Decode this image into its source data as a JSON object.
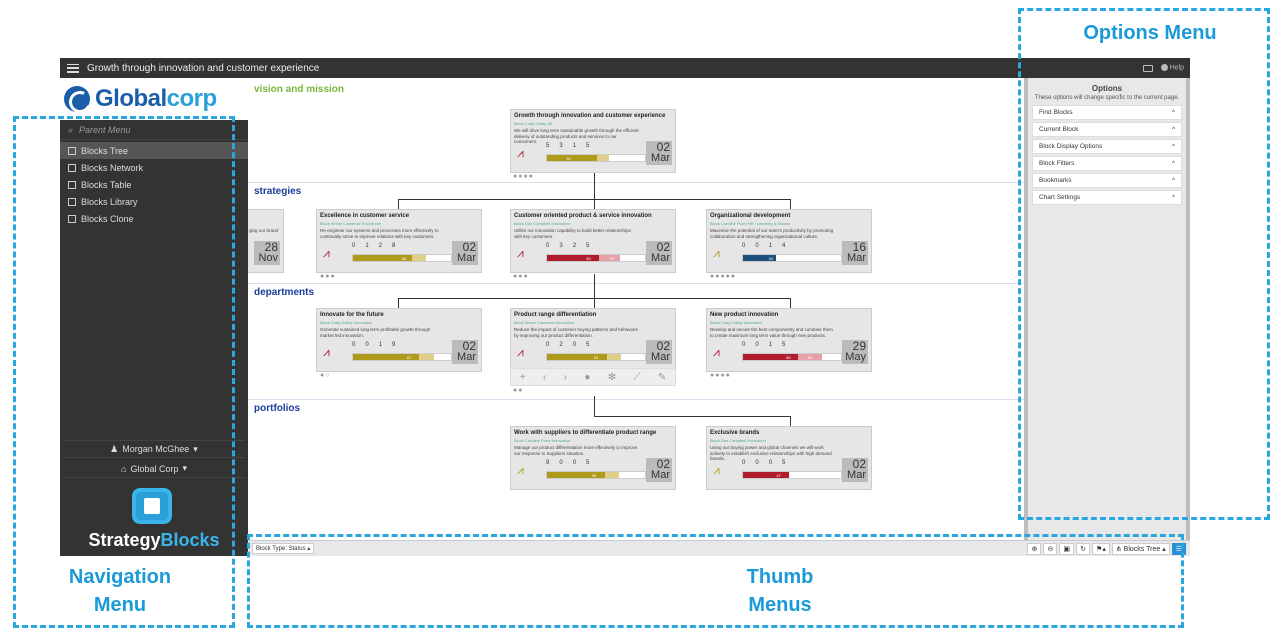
{
  "topbar": {
    "title": "Growth through innovation and customer experience",
    "help": "Help"
  },
  "nav": {
    "logo": {
      "main": "Global",
      "accent": "corp"
    },
    "parent_menu": "Parent Menu",
    "items": [
      {
        "label": "Blocks Tree",
        "active": true
      },
      {
        "label": "Blocks Network"
      },
      {
        "label": "Blocks Table"
      },
      {
        "label": "Blocks Library"
      },
      {
        "label": "Blocks Clone"
      }
    ],
    "user": "Morgan McGhee",
    "org": "Global Corp",
    "brand": {
      "main": "Strategy",
      "accent": "Blocks"
    }
  },
  "levels": {
    "vision": "vision and mission",
    "strategies": "strategies",
    "departments": "departments",
    "portfolios": "portfolios"
  },
  "cards": {
    "root": {
      "title": "Growth through innovation and customer experience",
      "meta": "Block  Craig Cailey  All",
      "desc": "We will drive long term sustainable growth through the efficient delivery of outstanding products and services to our consumers.",
      "stats": [
        "5",
        "3",
        "1",
        "5"
      ],
      "pct": "51",
      "day": "02",
      "month": "Mar",
      "dots": "●●●●"
    },
    "partial": {
      "desc": "ging our brand",
      "day": "28",
      "month": "Nov"
    },
    "s1": {
      "title": "Excellence in customer service",
      "meta": "Block  Simon Lawrence  Excellence",
      "desc": "Re-engineer our systems and processes more effectively to continually strive to improve relations with key customers.",
      "stats": [
        "0",
        "1",
        "2",
        "8"
      ],
      "pct": "60",
      "day": "02",
      "month": "Mar",
      "dots": "●●●"
    },
    "s2": {
      "title": "Customer oriented product & service innovation",
      "meta": "Block  Don Campbell  Innovation",
      "desc": "Utilize our innovation capability to build better relationships with key customers.",
      "stats": [
        "0",
        "3",
        "2",
        "5"
      ],
      "pct": "53",
      "pct2": "75",
      "day": "02",
      "month": "Mar",
      "dots": "●●●"
    },
    "s3": {
      "title": "Organizational development",
      "meta": "Block  Caroline Purre  HR / Learning & Growth",
      "desc": "Maximise the potential of our team's productivity by promoting collaboration and strengthening organizational culture.",
      "stats": [
        "0",
        "0",
        "1",
        "4"
      ],
      "pct": "34",
      "day": "16",
      "month": "Mar",
      "dots": "●●●●●"
    },
    "d1": {
      "title": "Innovate for the future",
      "meta": "Block  Craig Cailey  Innovation",
      "desc": "Generate sustained long term profitable growth through market led innovation.",
      "stats": [
        "0",
        "0",
        "1",
        "9"
      ],
      "pct": "67",
      "day": "02",
      "month": "Mar",
      "dots": "●○"
    },
    "d2": {
      "title": "Product range differentiation",
      "meta": "Block  Simon Lawrence  Innovation",
      "desc": "Reduce the impact of customer buying patterns and behaviors by improving our product differentiation.",
      "stats": [
        "0",
        "2",
        "0",
        "5"
      ],
      "pct": "61",
      "day": "02",
      "month": "Mar",
      "dots": "●●"
    },
    "d3": {
      "title": "New product innovation",
      "meta": "Block  Craig Cailey  Innovation",
      "desc": "Develop and secure the best componentry and combine them to create maximum long term value through new products.",
      "stats": [
        "0",
        "0",
        "1",
        "5"
      ],
      "pct": "56",
      "pct2": "81",
      "day": "29",
      "month": "May",
      "dots": "●●●●"
    },
    "p1": {
      "title": "Work with suppliers to differentiate product range",
      "meta": "Block  Caroline Purre  Innovation",
      "desc": "Manage our product differentiation more effectively to improve our response to Suppliers situation.",
      "stats": [
        "9",
        "0",
        "0",
        "5"
      ],
      "pct": "59",
      "day": "02",
      "month": "Mar"
    },
    "p2": {
      "title": "Exclusive brands",
      "meta": "Block  Don Campbell  Innovation",
      "desc": "Using our buying power and global channels we will work actively to establish exclusive relationships with high demand brands.",
      "stats": [
        "0",
        "0",
        "0",
        "5"
      ],
      "pct": "47",
      "day": "02",
      "month": "Mar"
    }
  },
  "options": {
    "title": "Options",
    "desc": "These options will change specific to the current page.",
    "items": [
      "Find Blocks",
      "Current Block",
      "Block Display Options",
      "Block Filters",
      "Bookmarks",
      "Chart Settings"
    ]
  },
  "bottombar": {
    "block_type": "Block Type: Status",
    "tree_btn": "Blocks Tree"
  },
  "annotations": {
    "options_menu": "Options Menu",
    "nav_menu_1": "Navigation",
    "nav_menu_2": "Menu",
    "thumb_menus_1": "Thumb",
    "thumb_menus_2": "Menus"
  },
  "colors": {
    "accent": "#1a9ad8",
    "vision": "#7ab83a",
    "level": "#1a3d9a",
    "olive": "#b09a1c",
    "red": "#b01c2e",
    "navy": "#1c4e7a"
  }
}
